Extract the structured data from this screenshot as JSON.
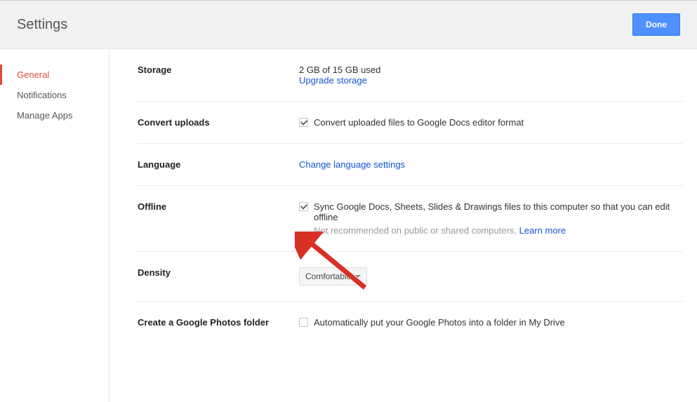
{
  "header": {
    "title": "Settings",
    "done_label": "Done"
  },
  "sidebar": {
    "items": [
      {
        "label": "General",
        "active": true
      },
      {
        "label": "Notifications",
        "active": false
      },
      {
        "label": "Manage Apps",
        "active": false
      }
    ]
  },
  "sections": {
    "storage": {
      "label": "Storage",
      "usage": "2 GB of 15 GB used",
      "upgrade_link": "Upgrade storage"
    },
    "convert_uploads": {
      "label": "Convert uploads",
      "checkbox_label": "Convert uploaded files to Google Docs editor format",
      "checked": true
    },
    "language": {
      "label": "Language",
      "link": "Change language settings"
    },
    "offline": {
      "label": "Offline",
      "checkbox_label": "Sync Google Docs, Sheets, Slides & Drawings files to this computer so that you can edit offline",
      "helper": "Not recommended on public or shared computers.",
      "learn_more": "Learn more",
      "checked": true
    },
    "density": {
      "label": "Density",
      "selected": "Comfortable"
    },
    "photos_folder": {
      "label": "Create a Google Photos folder",
      "checkbox_label": "Automatically put your Google Photos into a folder in My Drive",
      "checked": false
    }
  }
}
